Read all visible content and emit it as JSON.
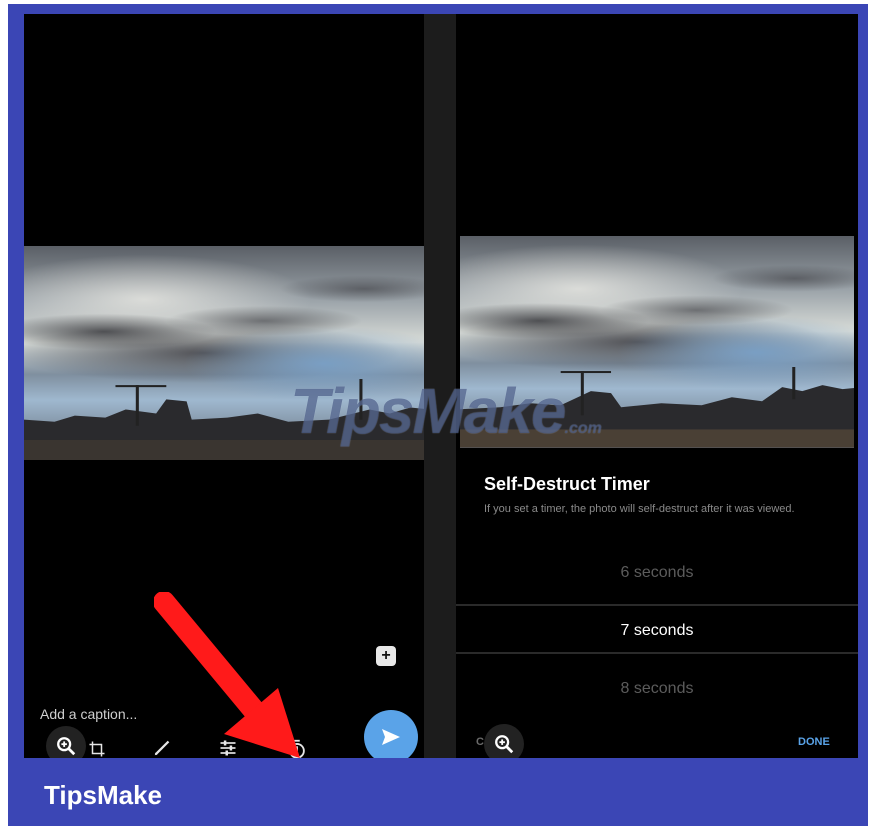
{
  "left_panel": {
    "caption_placeholder": "Add a caption..."
  },
  "right_panel": {
    "title": "Self-Destruct Timer",
    "description": "If you set a timer, the photo will self-destruct after it was viewed.",
    "options": [
      {
        "label": "6 seconds",
        "selected": false
      },
      {
        "label": "7 seconds",
        "selected": true
      },
      {
        "label": "8 seconds",
        "selected": false
      }
    ],
    "cancel_label": "CANCEL",
    "done_label": "DONE"
  },
  "watermark": {
    "text": "TipsMake",
    "suffix": ".com"
  },
  "brand": {
    "name": "TipsMake"
  },
  "colors": {
    "frame": "#3b46b5",
    "send_button": "#5aa3e8",
    "arrow": "#ff1a1a",
    "done": "#5aa3e8"
  },
  "icons": [
    "zoom-in-icon",
    "crop-icon",
    "brush-icon",
    "adjust-icon",
    "timer-icon",
    "send-icon",
    "add-sticker-icon"
  ]
}
